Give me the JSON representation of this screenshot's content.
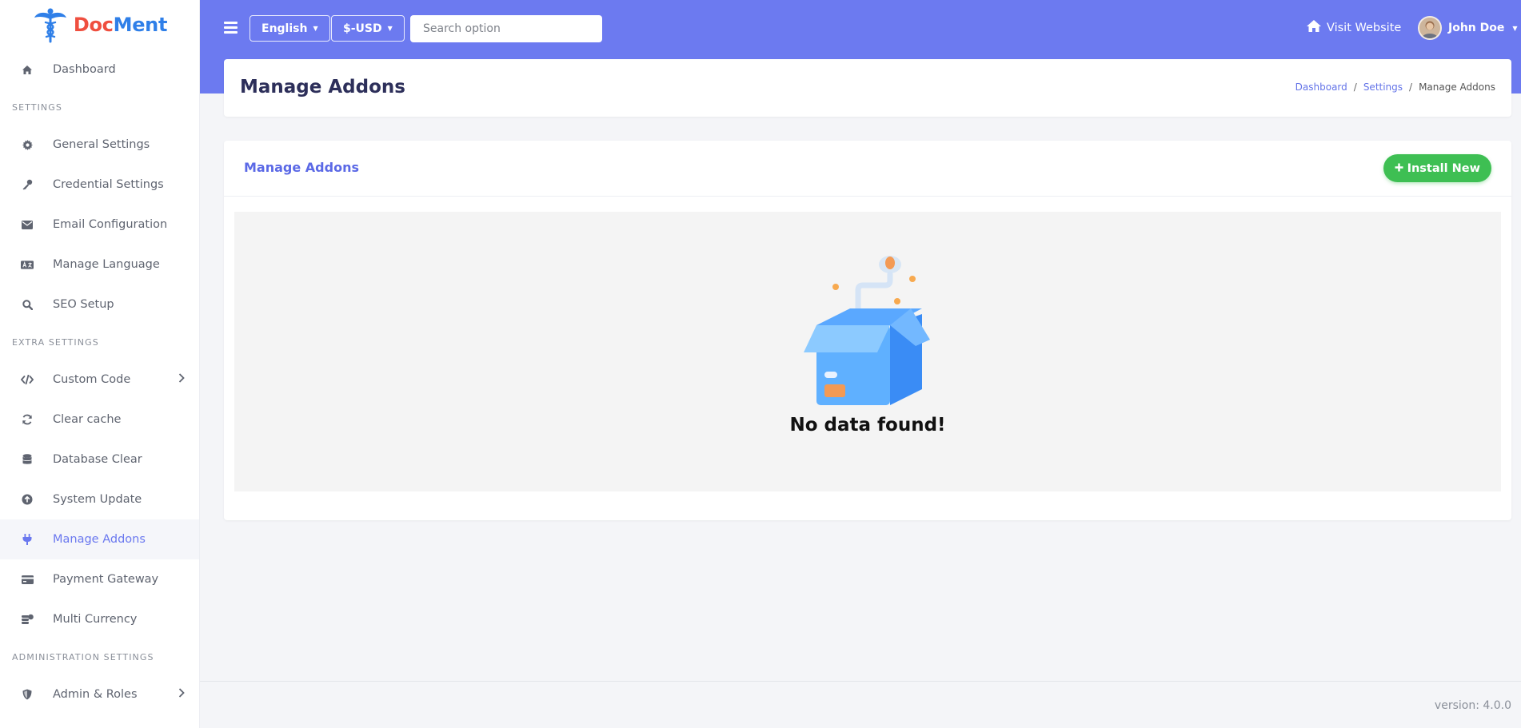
{
  "brand": {
    "doc": "Doc",
    "ment": "Ment"
  },
  "sidebar": {
    "dashboard": {
      "label": "Dashboard",
      "icon": "home-icon"
    },
    "sections": [
      {
        "title": "SETTINGS",
        "items": [
          {
            "label": "General Settings",
            "icon": "gear-icon"
          },
          {
            "label": "Credential Settings",
            "icon": "key-icon"
          },
          {
            "label": "Email Configuration",
            "icon": "envelope-icon"
          },
          {
            "label": "Manage Language",
            "icon": "language-icon"
          },
          {
            "label": "SEO Setup",
            "icon": "search-icon"
          }
        ]
      },
      {
        "title": "EXTRA SETTINGS",
        "items": [
          {
            "label": "Custom Code",
            "icon": "code-icon",
            "chevron": true
          },
          {
            "label": "Clear cache",
            "icon": "refresh-icon"
          },
          {
            "label": "Database Clear",
            "icon": "database-icon"
          },
          {
            "label": "System Update",
            "icon": "upload-icon"
          },
          {
            "label": "Manage Addons",
            "icon": "plug-icon",
            "active": true
          },
          {
            "label": "Payment Gateway",
            "icon": "card-icon"
          },
          {
            "label": "Multi Currency",
            "icon": "coins-icon"
          }
        ]
      },
      {
        "title": "ADMINISTRATION SETTINGS",
        "items": [
          {
            "label": "Admin & Roles",
            "icon": "shield-icon",
            "chevron": true
          }
        ]
      }
    ]
  },
  "topbar": {
    "language": "English",
    "currency": "$-USD",
    "search_placeholder": "Search option",
    "visit_website": "Visit Website",
    "user_name": "John Doe"
  },
  "page": {
    "title": "Manage Addons",
    "breadcrumb": [
      {
        "label": "Dashboard",
        "link": true
      },
      {
        "label": "Settings",
        "link": true
      },
      {
        "label": "Manage Addons",
        "link": false
      }
    ]
  },
  "card": {
    "title": "Manage Addons",
    "install_button": "Install New",
    "empty_text": "No data found!"
  },
  "footer": {
    "version": "version: 4.0.0"
  },
  "colors": {
    "accent": "#6c7af0",
    "success": "#3ebf53",
    "logo_red": "#ef4f3f",
    "logo_blue": "#2f7fe8"
  }
}
